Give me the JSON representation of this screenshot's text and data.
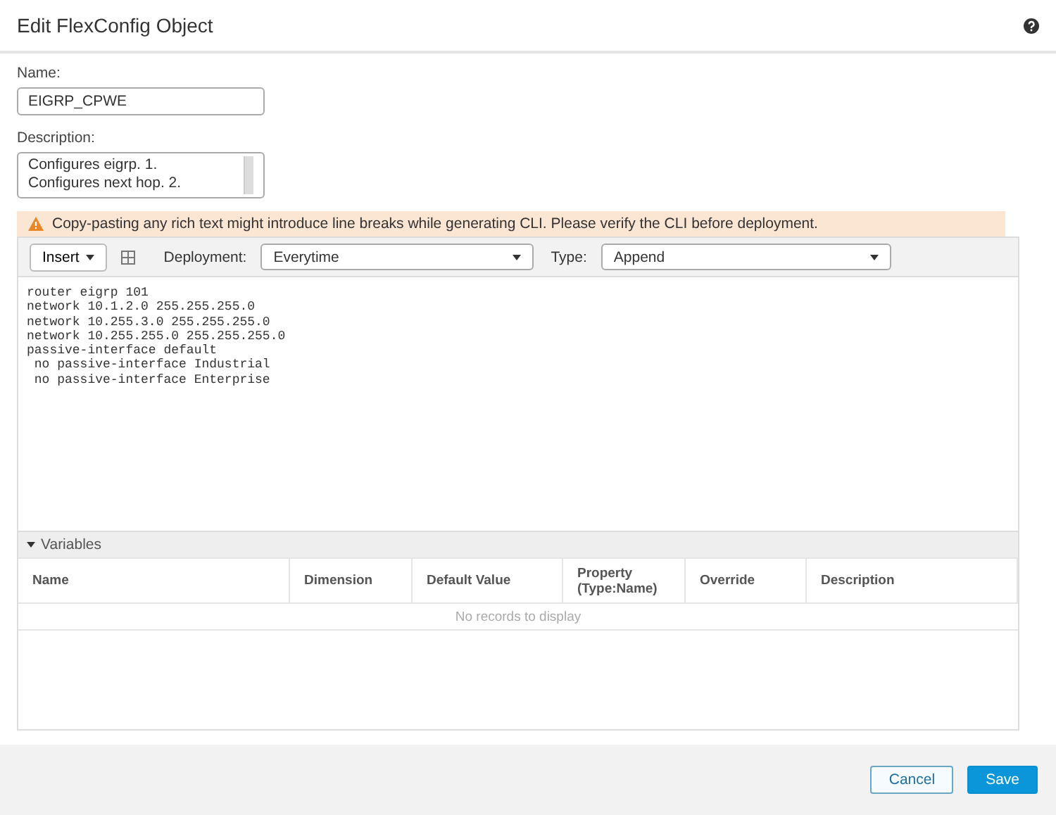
{
  "dialog": {
    "title": "Edit FlexConfig Object"
  },
  "name_field": {
    "label": "Name:",
    "value": "EIGRP_CPWE"
  },
  "description_field": {
    "label": "Description:",
    "lines": [
      "Configures eigrp. 1.",
      "Configures next hop. 2."
    ]
  },
  "warning": "Copy-pasting any rich text might introduce line breaks while generating CLI. Please verify the CLI before deployment.",
  "toolbar": {
    "insert_button": "Insert",
    "deployment": {
      "label": "Deployment:",
      "value": "Everytime"
    },
    "type": {
      "label": "Type:",
      "value": "Append"
    }
  },
  "code_lines": [
    "router eigrp 101",
    "network 10.1.2.0 255.255.255.0",
    "network 10.255.3.0 255.255.255.0",
    "network 10.255.255.0 255.255.255.0",
    "passive-interface default",
    " no passive-interface Industrial",
    " no passive-interface Enterprise"
  ],
  "variables": {
    "title": "Variables",
    "expanded": true,
    "columns": [
      "Name",
      "Dimension",
      "Default Value",
      "Property (Type:Name)",
      "Override",
      "Description"
    ],
    "empty_text": "No records to display"
  },
  "buttons": [
    {
      "label": "Cancel",
      "kind": "secondary"
    },
    {
      "label": "Save",
      "kind": "primary"
    }
  ]
}
